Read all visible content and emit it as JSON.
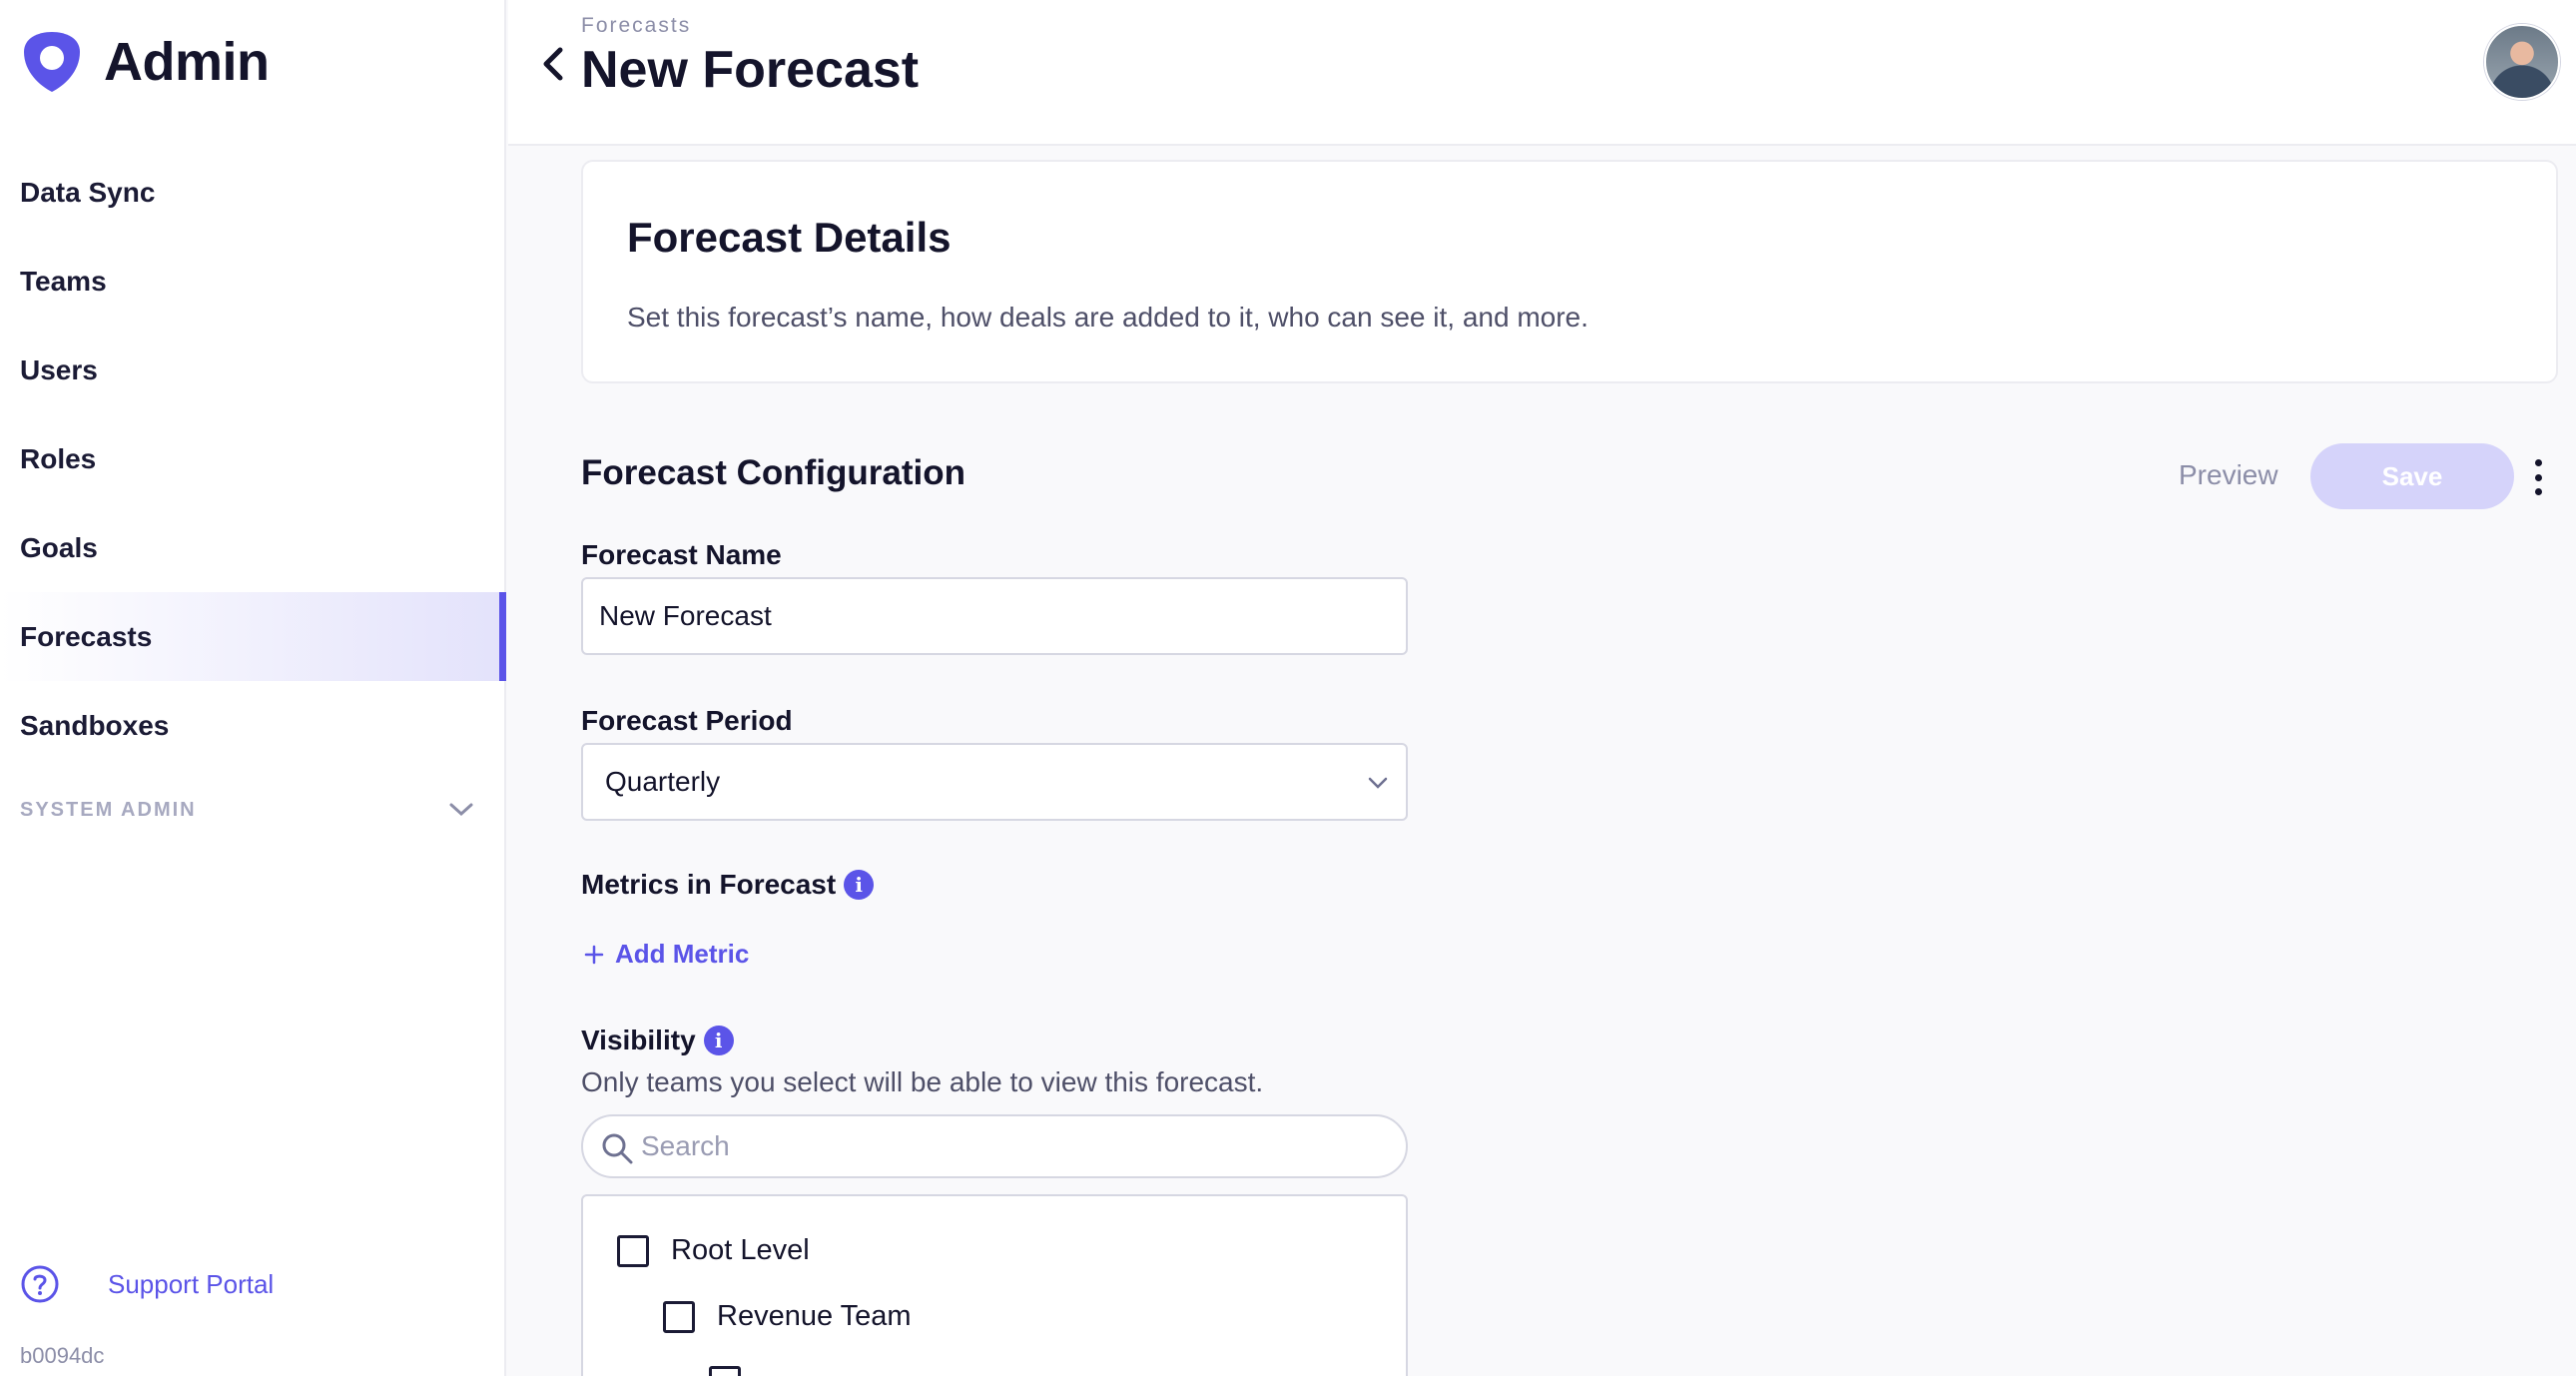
{
  "app": {
    "name": "Admin"
  },
  "sidebar": {
    "items": [
      {
        "label": "Data Sync"
      },
      {
        "label": "Teams"
      },
      {
        "label": "Users"
      },
      {
        "label": "Roles"
      },
      {
        "label": "Goals"
      },
      {
        "label": "Forecasts",
        "active": true
      },
      {
        "label": "Sandboxes"
      }
    ],
    "section": "SYSTEM ADMIN",
    "support_label": "Support Portal",
    "version": "b0094dc"
  },
  "header": {
    "breadcrumb": "Forecasts",
    "title": "New Forecast"
  },
  "details": {
    "title": "Forecast Details",
    "description": "Set this forecast’s name, how deals are added to it, who can see it, and more."
  },
  "config": {
    "title": "Forecast Configuration",
    "preview_label": "Preview",
    "save_label": "Save",
    "name_label": "Forecast Name",
    "name_value": "New Forecast",
    "period_label": "Forecast Period",
    "period_value": "Quarterly",
    "metrics_label": "Metrics in Forecast",
    "add_metric_label": "Add Metric",
    "visibility_label": "Visibility",
    "visibility_desc": "Only teams you select will be able to view this forecast.",
    "search_placeholder": "Search",
    "tree": [
      {
        "label": "Root Level"
      },
      {
        "label": "Revenue Team"
      }
    ]
  },
  "colors": {
    "accent": "#5b54e8",
    "save_disabled": "#d5d3fa",
    "text": "#14142b"
  }
}
